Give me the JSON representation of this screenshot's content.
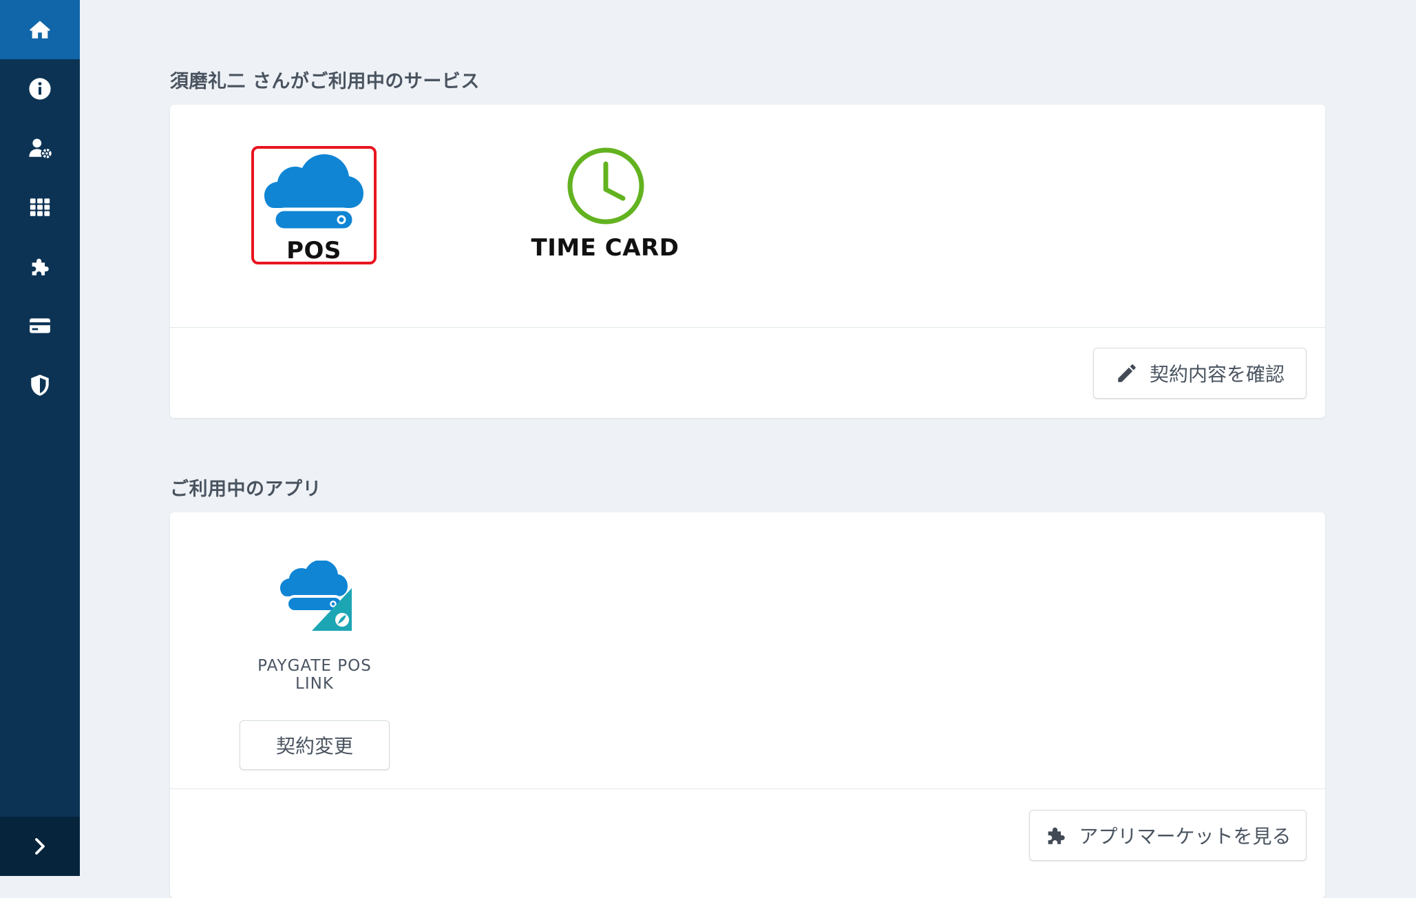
{
  "sidebar": {
    "items": [
      {
        "icon": "home-icon",
        "active": true
      },
      {
        "icon": "info-icon"
      },
      {
        "icon": "user-settings-icon"
      },
      {
        "icon": "apps-grid-icon"
      },
      {
        "icon": "puzzle-icon"
      },
      {
        "icon": "credit-card-icon"
      },
      {
        "icon": "shield-icon"
      }
    ],
    "expand_icon": "chevron-right-icon",
    "colors": {
      "background": "#0c3354",
      "active": "#1066a8",
      "footer": "#06253d"
    }
  },
  "services": {
    "title": "須磨礼二 さんがご利用中のサービス",
    "items": [
      {
        "label": "POS",
        "icon": "pos-cloud-icon",
        "selected": true
      },
      {
        "label": "TIME CARD",
        "icon": "clock-icon"
      }
    ],
    "contract_button": {
      "label": "契約内容を確認",
      "icon": "pencil-icon"
    }
  },
  "apps": {
    "title": "ご利用中のアプリ",
    "items": [
      {
        "label": "PAYGATE POS LINK",
        "icon": "paygate-pos-link-icon",
        "change_button": "契約変更"
      }
    ],
    "market_button": {
      "label": "アプリマーケットを見る",
      "icon": "puzzle-icon"
    }
  },
  "colors": {
    "pos_blue": "#0f85d4",
    "timecard_green": "#62b31f",
    "selection_red": "#e8151f",
    "paygate_teal": "#1ca6b4"
  }
}
